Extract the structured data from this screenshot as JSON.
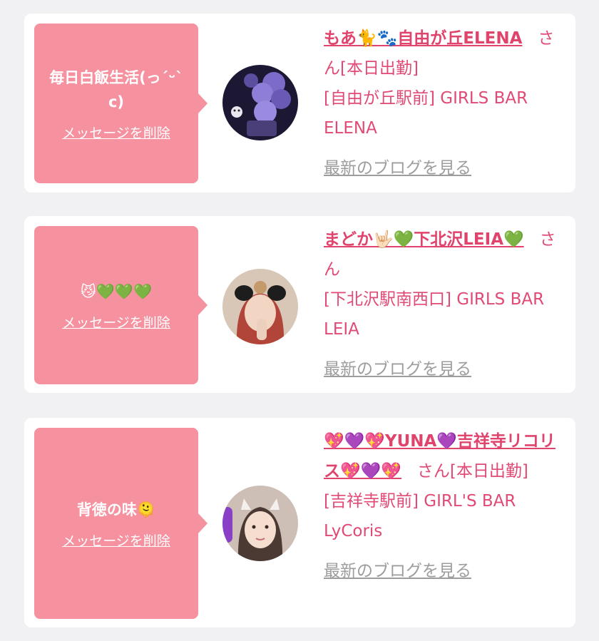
{
  "cards": [
    {
      "message": "毎日白飯生活(っˊᵕˋc)",
      "delete_label": "メッセージを削除",
      "name": "もあ🐈🐾自由が丘ELENA",
      "honorific": "さん",
      "status": "[本日出勤]",
      "shop": "[自由が丘駅前] GIRLS BAR ELENA",
      "blog_link": "最新のブログを見る"
    },
    {
      "message": "😼💚💚💚",
      "delete_label": "メッセージを削除",
      "name": "まどか🤟🏻💚下北沢LEIA💚",
      "honorific": "さん",
      "status": "",
      "shop": "[下北沢駅南西口] GIRLS BAR LEIA",
      "blog_link": "最新のブログを見る"
    },
    {
      "message": "背徳の味🫠",
      "delete_label": "メッセージを削除",
      "name": "💖💜💖YUNA💜吉祥寺リコリス💖💜💖",
      "honorific": "さん",
      "status": "[本日出勤]",
      "shop": "[吉祥寺駅前] GIRL'S BAR LyCoris",
      "blog_link": "最新のブログを見る"
    }
  ],
  "colors": {
    "background": "#f1f1f3",
    "bubble": "#f6919f",
    "accent_text": "#e04a74",
    "muted_link": "#9d9d9d"
  }
}
